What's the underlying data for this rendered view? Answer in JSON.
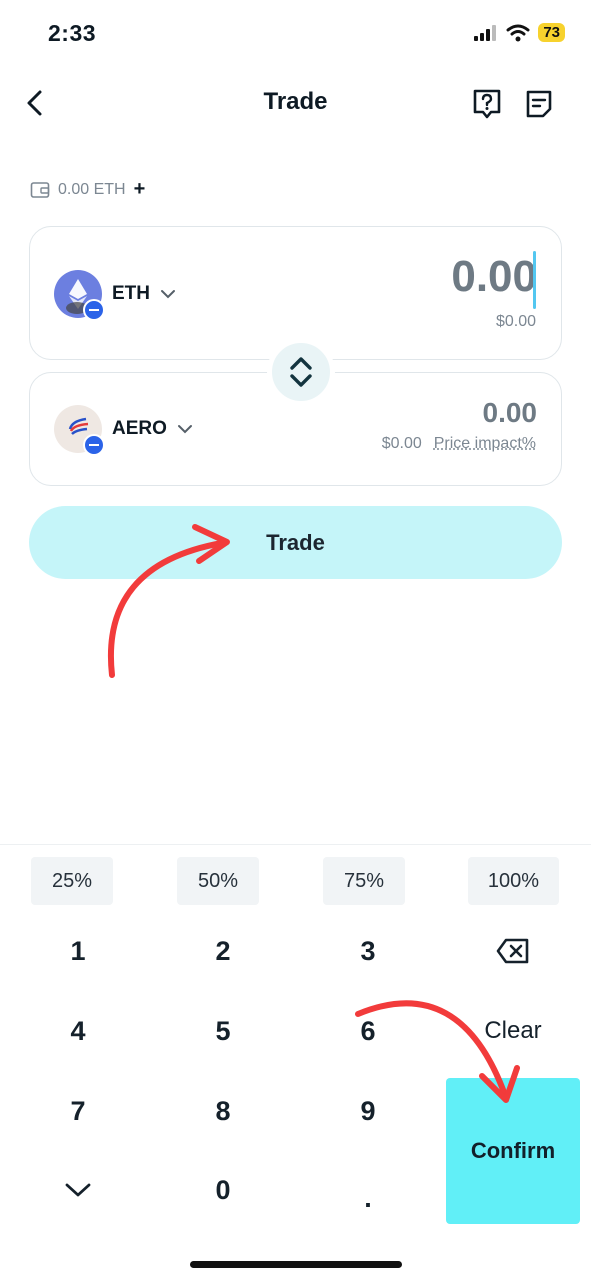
{
  "status_bar": {
    "time": "2:33",
    "battery": "73"
  },
  "header": {
    "title": "Trade",
    "help_icon": "question-bubble-icon",
    "history_icon": "note-icon"
  },
  "balance": {
    "text": "0.00 ETH",
    "add_symbol": "+"
  },
  "from": {
    "token": "ETH",
    "amount": "0.00",
    "usd": "$0.00"
  },
  "to": {
    "token": "AERO",
    "amount": "0.00",
    "usd": "$0.00",
    "impact_label": "Price impact%"
  },
  "trade_button": "Trade",
  "percent_buttons": [
    "25%",
    "50%",
    "75%",
    "100%"
  ],
  "keypad": {
    "k1": "1",
    "k2": "2",
    "k3": "3",
    "k4": "4",
    "k5": "5",
    "k6": "6",
    "k7": "7",
    "k8": "8",
    "k9": "9",
    "k0": "0",
    "dot": ".",
    "clear": "Clear"
  },
  "confirm_label": "Confirm",
  "colors": {
    "accent_light": "#c5f5f9",
    "accent": "#61eff7",
    "annotation_arrow": "#f23b3b"
  }
}
